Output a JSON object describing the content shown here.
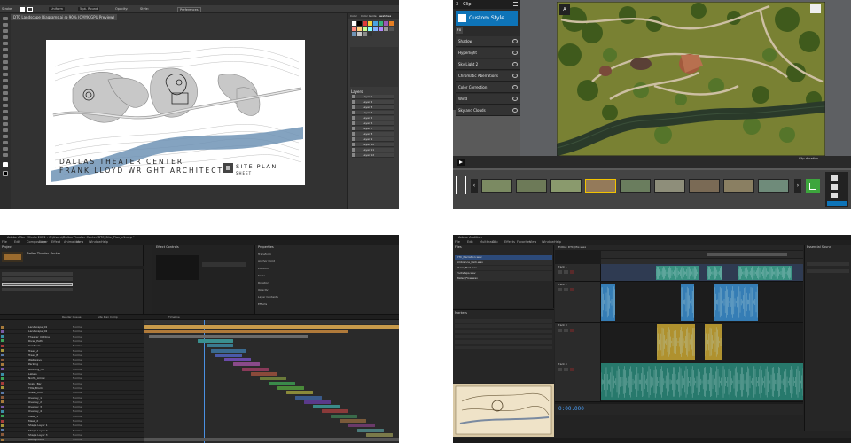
{
  "illustrator": {
    "doc_tab": "DTC Landscape Diagrams.ai @ 90% (CMYK/GPU Preview)",
    "ctrl_stroke_label": "Stroke",
    "ctrl_uniform": "Uniform",
    "ctrl_pt": "5 pt. Round",
    "ctrl_opacity": "Opacity:",
    "ctrl_style": "Style:",
    "ctrl_prefs": "Preferences",
    "panel_tabs": [
      "Color",
      "Color Guide",
      "Swatches"
    ],
    "layers_title": "Layers",
    "layers": [
      "Layer 1",
      "Layer 2",
      "Layer 3",
      "Layer 4",
      "Layer 5",
      "Layer 6",
      "Layer 7",
      "Layer 8",
      "Layer 9",
      "Layer 10",
      "Layer 11",
      "Layer 12"
    ],
    "drawing_title_line1": "DALLAS THEATER CENTER",
    "drawing_title_line2": "FRANK LLOYD WRIGHT ARCHITECT",
    "sheet_title": "SITE PLAN",
    "sheet_sub": "SHEET"
  },
  "twinmotion": {
    "header": "3 - Clip",
    "style_label": "Custom Style",
    "fx_label": "FX",
    "effects": [
      "Shadow",
      "Hyperlight",
      "Sky Light 2",
      "Chromatic Aberrations",
      "Color Correction",
      "Wind",
      "Sky and Clouds"
    ],
    "clip_time": "Clip duration",
    "progress_fraction": 1.0,
    "thumb_labels": [
      "",
      "",
      "",
      "",
      "",
      "",
      "",
      "",
      ""
    ]
  },
  "aftereffects": {
    "title": "Adobe After Effects 2022 - C:\\Users\\Dallas Theater Center\\DTC_Site_Plan_v1.aep *",
    "menu": [
      "File",
      "Edit",
      "Composition",
      "Layer",
      "Effect",
      "Animation",
      "View",
      "Window",
      "Help"
    ],
    "project_title": "Project",
    "project_item": "Dallas Theater Center",
    "effect_controls_title": "Effect Controls",
    "properties_title": "Properties",
    "properties": [
      "Transform",
      "Anchor Point",
      "Position",
      "Scale",
      "Rotation",
      "Opacity",
      "Layer Contents",
      "Effects"
    ],
    "tabs": [
      "Render Queue",
      "Site Plan Comp",
      "Timeline"
    ],
    "layers": [
      {
        "name": "Landscape_01",
        "mode": "Normal"
      },
      {
        "name": "Landscape_02",
        "mode": "Normal"
      },
      {
        "name": "Theater_Outline",
        "mode": "Normal"
      },
      {
        "name": "River_Path",
        "mode": "Normal"
      },
      {
        "name": "Contours",
        "mode": "Normal"
      },
      {
        "name": "Trees_A",
        "mode": "Normal"
      },
      {
        "name": "Trees_B",
        "mode": "Normal"
      },
      {
        "name": "Walkways",
        "mode": "Normal"
      },
      {
        "name": "Parking",
        "mode": "Normal"
      },
      {
        "name": "Building_Fill",
        "mode": "Normal"
      },
      {
        "name": "Labels",
        "mode": "Normal"
      },
      {
        "name": "North_Arrow",
        "mode": "Normal"
      },
      {
        "name": "Scale_Bar",
        "mode": "Normal"
      },
      {
        "name": "Title_Block",
        "mode": "Normal"
      },
      {
        "name": "Sheet_Info",
        "mode": "Normal"
      },
      {
        "name": "Overlay_1",
        "mode": "Normal"
      },
      {
        "name": "Overlay_2",
        "mode": "Normal"
      },
      {
        "name": "Overlay_3",
        "mode": "Normal"
      },
      {
        "name": "Overlay_4",
        "mode": "Normal"
      },
      {
        "name": "Mask_1",
        "mode": "Normal"
      },
      {
        "name": "Mask_2",
        "mode": "Normal"
      },
      {
        "name": "Shape Layer 1",
        "mode": "Normal"
      },
      {
        "name": "Shape Layer 2",
        "mode": "Normal"
      },
      {
        "name": "Shape Layer 3",
        "mode": "Normal"
      },
      {
        "name": "Background",
        "mode": "Normal"
      }
    ]
  },
  "audition": {
    "title": "Adobe Audition",
    "menu": [
      "File",
      "Edit",
      "Multitrack",
      "Clip",
      "Effects",
      "Favorites",
      "View",
      "Window",
      "Help"
    ],
    "files_title": "Files",
    "files": [
      "DTC_Narration.wav",
      "Ambience_Park.wav",
      "Music_Bed.wav",
      "Footsteps.wav",
      "Water_Flow.wav"
    ],
    "media_title": "Markers",
    "editor_title": "Editor: DTC_Mix.sesx",
    "tracks": [
      "Track 1",
      "Track 2",
      "Track 3",
      "Track 4"
    ],
    "time": "0:00.000",
    "right_title": "Essential Sound"
  }
}
